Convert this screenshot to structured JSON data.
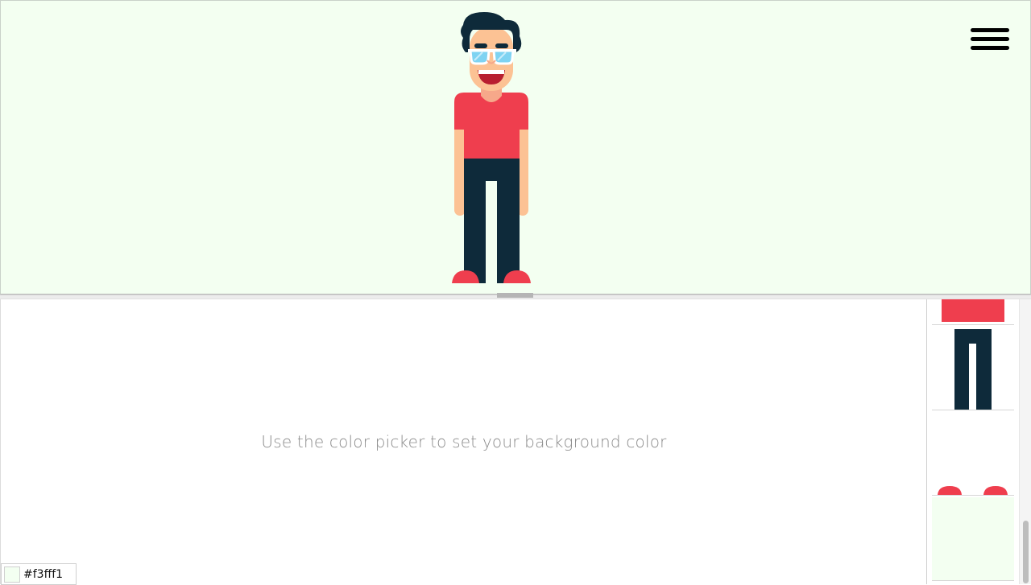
{
  "stage": {
    "background": "#f3fff1",
    "menu_icon": "hamburger-menu-icon"
  },
  "character": {
    "hair_color": "#0e2a3a",
    "skin_color": "#fcc294",
    "shirt_color": "#ef3e4e",
    "pants_color": "#0e2a3a",
    "shoe_color": "#ef3e4e",
    "glasses_lens_color": "#7fd3f2",
    "mouth_color": "#b81f30"
  },
  "editor": {
    "hint": "Use the color picker to set your background color"
  },
  "color_picker": {
    "value": "#f3fff1"
  },
  "parts_panel": {
    "items": [
      "shirt",
      "pants",
      "shoes",
      "background"
    ]
  }
}
